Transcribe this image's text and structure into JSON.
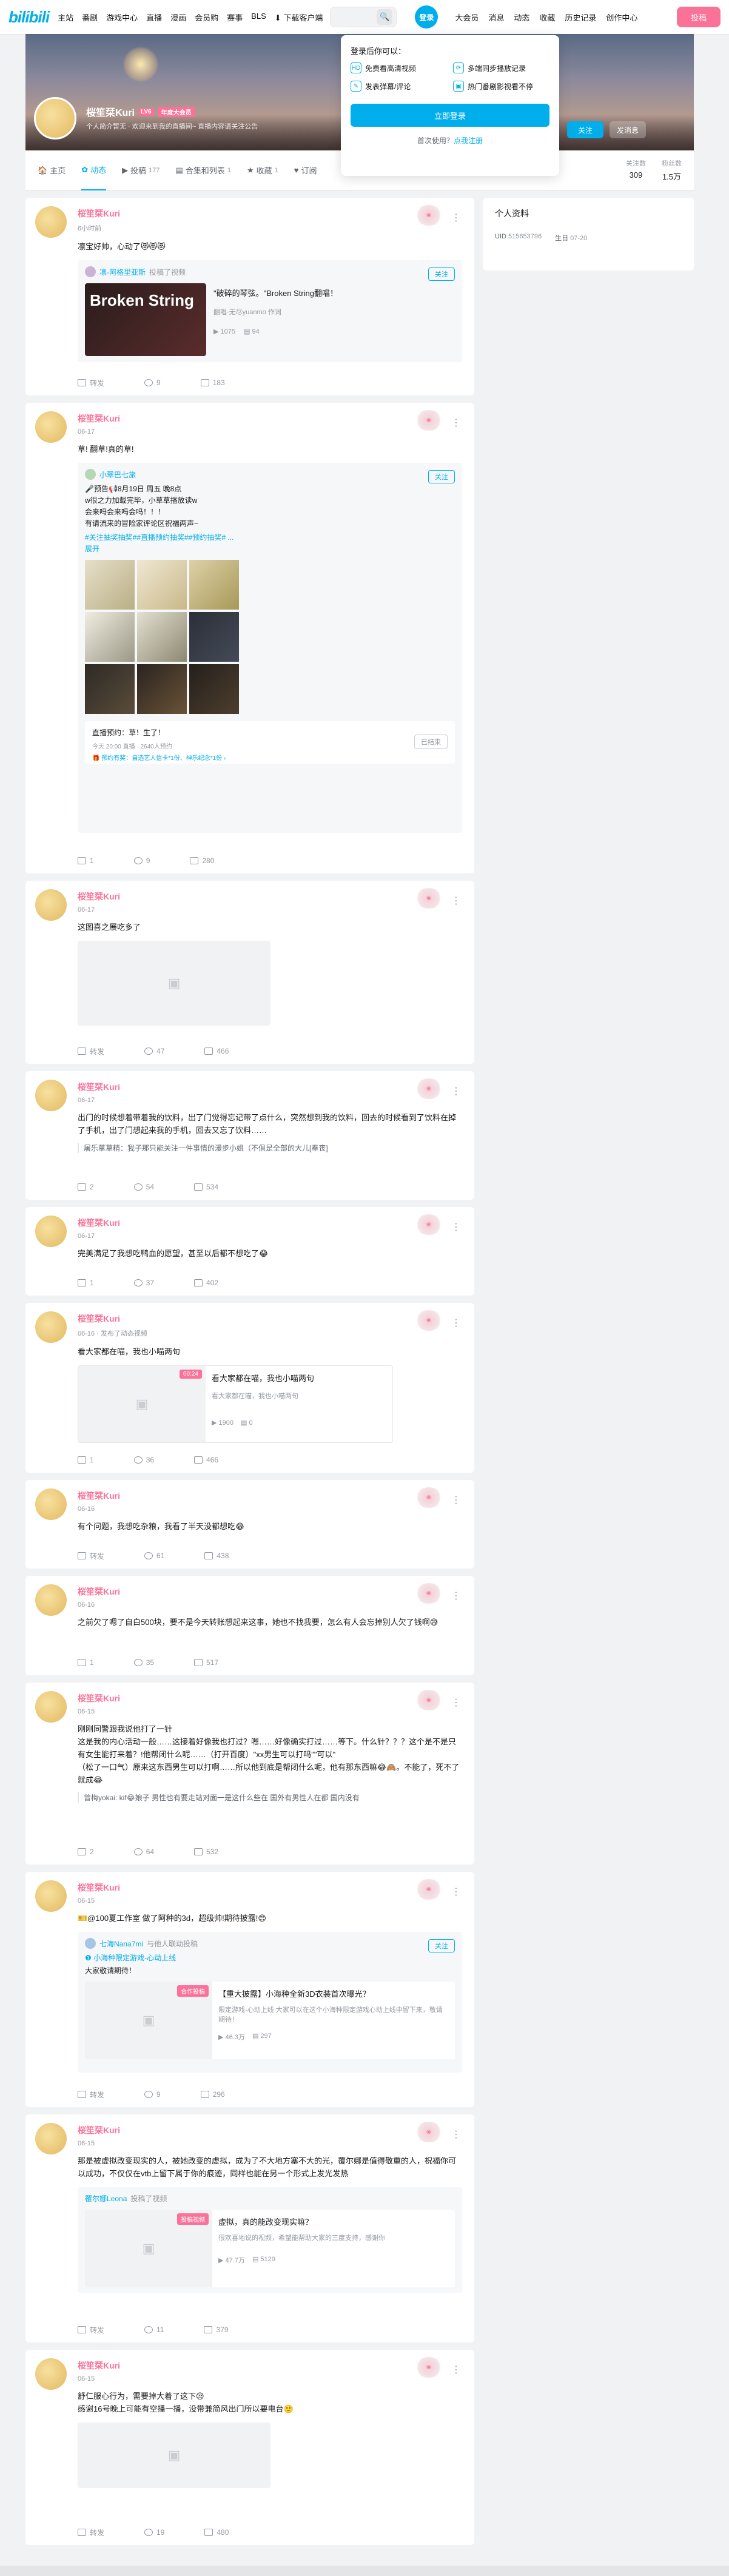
{
  "nav": {
    "logo": "bilibili",
    "left": [
      "主站",
      "番剧",
      "游戏中心",
      "直播",
      "漫画",
      "会员购",
      "赛事",
      "BLS"
    ],
    "download": "下载客户端",
    "login": "登录",
    "right": [
      "大会员",
      "消息",
      "动态",
      "收藏",
      "历史记录",
      "创作中心"
    ],
    "upload": "投稿"
  },
  "profile": {
    "name": "桜笙栞Kuri",
    "level": "LV6",
    "vip": "年度大会员",
    "sign": "个人简介暂无 · 欢迎来到我的直播间~ 直播内容请关注公告",
    "follow": "关注",
    "message": "发消息"
  },
  "tabs": [
    {
      "label": "主页",
      "count": ""
    },
    {
      "label": "动态",
      "count": ""
    },
    {
      "label": "投稿",
      "count": "177"
    },
    {
      "label": "合集和列表",
      "count": "1"
    },
    {
      "label": "收藏",
      "count": "1"
    },
    {
      "label": "订阅",
      "count": ""
    }
  ],
  "stats": [
    {
      "label": "关注数",
      "value": "309"
    },
    {
      "label": "粉丝数",
      "value": "1.5万"
    }
  ],
  "login_popup": {
    "title": "登录后你可以：",
    "perks": [
      "免费看高清视频",
      "多端同步播放记录",
      "发表弹幕/评论",
      "热门番剧影视看不停"
    ],
    "button": "立即登录",
    "reg_text": "首次使用？",
    "reg_link": "点我注册"
  },
  "sidebar": {
    "title": "个人资料",
    "uid_label": "UID",
    "uid": "515653796",
    "bday_label": "生日",
    "bday": "07-20"
  },
  "feed": [
    {
      "time": "6小时前",
      "text": "凛宝好帅，心动了😻😻😻",
      "ref": {
        "author": "凛-阿格里亚斯",
        "tag": "投稿了视频",
        "title": "\"破碎的琴弦。\"Broken String翻唱！",
        "desc": "翻唱·无尽yuanmo 作词",
        "play": "1075",
        "danmaku": "94",
        "cover": "Broken String"
      },
      "acts": [
        "转发",
        "9",
        "183"
      ]
    },
    {
      "time": "06-17",
      "text": "草! 翻草!真的草!",
      "ref": {
        "author": "小翠巴七旅",
        "text": "🎤预告📢8月19日 周五 晚8点\nw很之力加载完毕，小草草播放读w\n会来吗会来吗会吗！！！\n有请流来的冒险家评论区祝福两声~",
        "tags": "#关注抽奖抽奖##直播预约抽奖##预约抽奖# ...",
        "expand": "展开",
        "live_title": "直播预约：草！生了！",
        "live_time": "今天 20:00 直播 · 2640人预约",
        "live_award": "🎁 预约有奖：自选艺人信卡*1份、神乐纪念*1份 ›",
        "live_btn": "已结束"
      },
      "acts": [
        "1",
        "9",
        "280"
      ]
    },
    {
      "time": "06-17",
      "text": "这图喜之展吃多了",
      "acts": [
        "转发",
        "47",
        "466"
      ]
    },
    {
      "time": "06-17",
      "text": "出门的时候想着带着我的饮料，出了门觉得忘记带了点什么，突然想到我的饮料，回去的时候看到了饮料在掉了手机，出了门想起来我的手机，回去又忘了饮料……",
      "comment": "屠乐草草精：我子那只能关注一件事情的漫步小姐（不俱是全部的大儿[奉丧]",
      "acts": [
        "2",
        "54",
        "534"
      ]
    },
    {
      "time": "06-17",
      "text": "完美满足了我想吃鸭血的愿望，甚至以后都不想吃了😂",
      "acts": [
        "1",
        "37",
        "402"
      ]
    },
    {
      "time": "06-16 · 发布了动态视频",
      "text": "看大家都在喵，我也小喵两句",
      "ref": {
        "title": "看大家都在喵，我也小喵两句",
        "desc": "看大家都在喵，我也小喵两句",
        "duration": "00:24",
        "play": "1900",
        "danmaku": "0"
      },
      "acts": [
        "1",
        "36",
        "466"
      ]
    },
    {
      "time": "06-16",
      "text": "有个问题，我想吃杂粮，我看了半天没都想吃😂",
      "acts": [
        "转发",
        "61",
        "438"
      ]
    },
    {
      "time": "06-16",
      "text": "之前欠了嗯了自白500块，要不是今天转账想起来这事，她也不找我要，怎么有人会忘掉别人欠了钱啊😅",
      "acts": [
        "1",
        "35",
        "517"
      ]
    },
    {
      "time": "06-15",
      "text": "刚刚同警跟我说他打了一针\n这是我的内心活动一般……这接着好像我也打过？嗯……好像确实打过……等下。什么针？？？这个是不是只有女生能打来着？!他帮闭什么呢……（打开百度）\"xx男生可以打吗\"\"可以\"\n（松了一口气）原来这东西男生可以打啊……所以他到底是帮闭什么呢，他有那东西嘛😂🙈。不能了，死不了就成😂",
      "comment": "曾梅yokai: kif😂娘子 男性也有要走站对面一是这什么些在 国外有男性人在都 国内没有",
      "acts": [
        "2",
        "64",
        "532"
      ]
    },
    {
      "time": "06-15",
      "text": "🎫@100夏工作室 做了阿种的3d，超级帅!期待披露!😍",
      "ref": {
        "author": "七海Nana7mi",
        "tag": "与他人联动投稿",
        "sub": "❶ 小海种限定游戏-心动上线",
        "subtext": "大家敬请期待！",
        "title": "【重大披露】小海种全新3D衣装首次曝光？",
        "desc": "限定游戏-心动上线 大家可以在这个小海种限定游戏心动上线中留下来，敬请期待！",
        "badge": "合作投稿",
        "play": "46.3万",
        "danmaku": "297"
      },
      "acts": [
        "转发",
        "9",
        "296"
      ]
    },
    {
      "time": "06-15",
      "text": "那是被虚拟改变现实的人，被她改变的虚拟，成为了不大地方塞不大的光，覆尔娜是值得敬重的人，祝福你可以成功，不仅仅在vtb上留下属于你的痕迹，同样也能在另一个形式上发光发热",
      "ref": {
        "author": "覆尔娜Leona",
        "tag": "投稿了视频",
        "title": "虚拟，真的能改变现实嘛？",
        "desc": "很欢喜地说的视频，希望能帮助大家的三度支持，感谢你",
        "badge": "投稿视频",
        "play": "47.7万",
        "danmaku": "5129"
      },
      "acts": [
        "转发",
        "11",
        "379"
      ]
    },
    {
      "time": "06-15",
      "text": "舒仁服心行为，需要掉大着了这下😒\n感谢16号晚上可能有空播一播，没带兼简风出门所以要电台🙂",
      "acts": [
        "转发",
        "19",
        "480"
      ]
    }
  ]
}
